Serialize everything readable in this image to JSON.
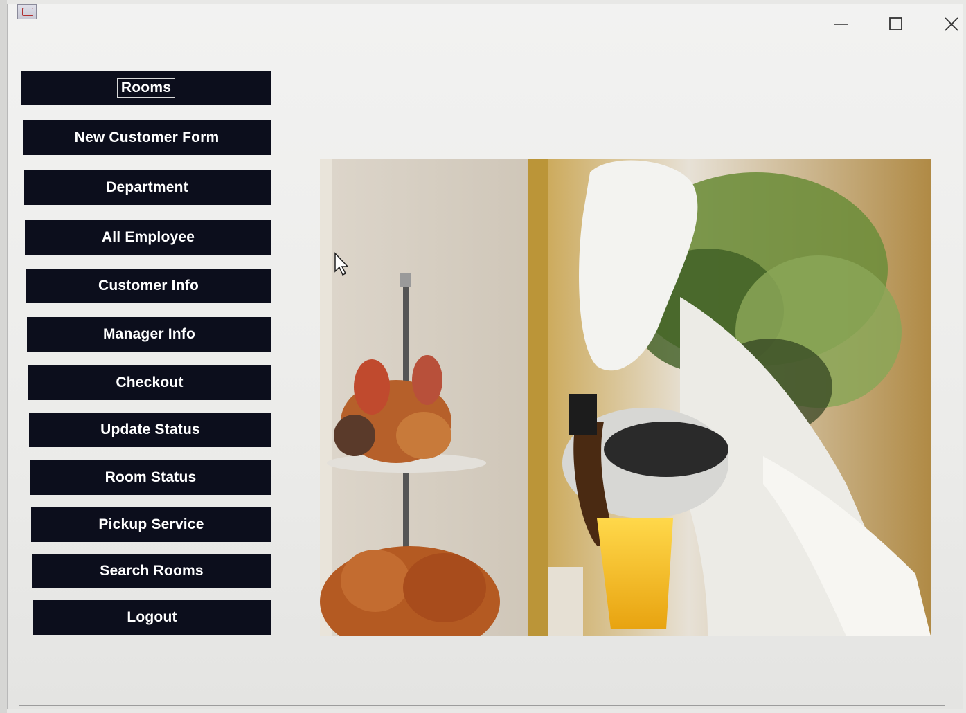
{
  "window": {
    "icon": "java-app-icon",
    "controls": {
      "minimize_icon": "minimize-icon",
      "maximize_icon": "maximize-icon",
      "close_icon": "close-icon"
    }
  },
  "menu": {
    "focused_index": 0,
    "button_color": "#0c0e1c",
    "text_color": "#ffffff",
    "items": [
      {
        "label": "Rooms"
      },
      {
        "label": "New Customer Form"
      },
      {
        "label": "Department"
      },
      {
        "label": "All Employee"
      },
      {
        "label": "Customer Info"
      },
      {
        "label": "Manager Info"
      },
      {
        "label": "Checkout"
      },
      {
        "label": "Update Status"
      },
      {
        "label": "Room Status"
      },
      {
        "label": "Pickup Service"
      },
      {
        "label": "Search Rooms"
      },
      {
        "label": "Logout"
      }
    ]
  },
  "image": {
    "subject": "hotel-breakfast-service-photo"
  }
}
